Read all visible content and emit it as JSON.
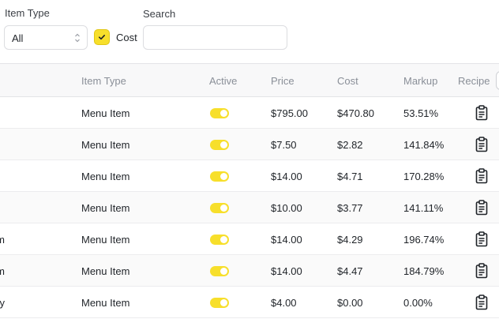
{
  "filters": {
    "item_type_label": "Item Type",
    "item_type_value": "All",
    "cost_checkbox_label": "Cost",
    "cost_checked": true,
    "search_label": "Search",
    "search_value": ""
  },
  "colors": {
    "accent": "#f7df2b",
    "header_bg": "#f8f8f9",
    "muted_text": "#8a8f98"
  },
  "table": {
    "headers": {
      "item_type": "Item Type",
      "active": "Active",
      "price": "Price",
      "cost": "Cost",
      "markup": "Markup",
      "recipe": "Recipe"
    },
    "rows": [
      {
        "name": "",
        "item_type": "Menu Item",
        "active": true,
        "price": "$795.00",
        "cost": "$470.80",
        "markup": "53.51%",
        "recipe_icon": "clipboard-icon"
      },
      {
        "name": "",
        "item_type": "Menu Item",
        "active": true,
        "price": "$7.50",
        "cost": "$2.82",
        "markup": "141.84%",
        "recipe_icon": "clipboard-icon"
      },
      {
        "name": "",
        "item_type": "Menu Item",
        "active": true,
        "price": "$14.00",
        "cost": "$4.71",
        "markup": "170.28%",
        "recipe_icon": "clipboard-icon"
      },
      {
        "name": "",
        "item_type": "Menu Item",
        "active": true,
        "price": "$10.00",
        "cost": "$3.77",
        "markup": "141.11%",
        "recipe_icon": "clipboard-icon"
      },
      {
        "name": "m",
        "item_type": "Menu Item",
        "active": true,
        "price": "$14.00",
        "cost": "$4.29",
        "markup": "196.74%",
        "recipe_icon": "clipboard-icon"
      },
      {
        "name": "m",
        "item_type": "Menu Item",
        "active": true,
        "price": "$14.00",
        "cost": "$4.47",
        "markup": "184.79%",
        "recipe_icon": "clipboard-icon"
      },
      {
        "name": "y",
        "item_type": "Menu Item",
        "active": true,
        "price": "$4.00",
        "cost": "$0.00",
        "markup": "0.00%",
        "recipe_icon": "clipboard-icon"
      }
    ]
  }
}
